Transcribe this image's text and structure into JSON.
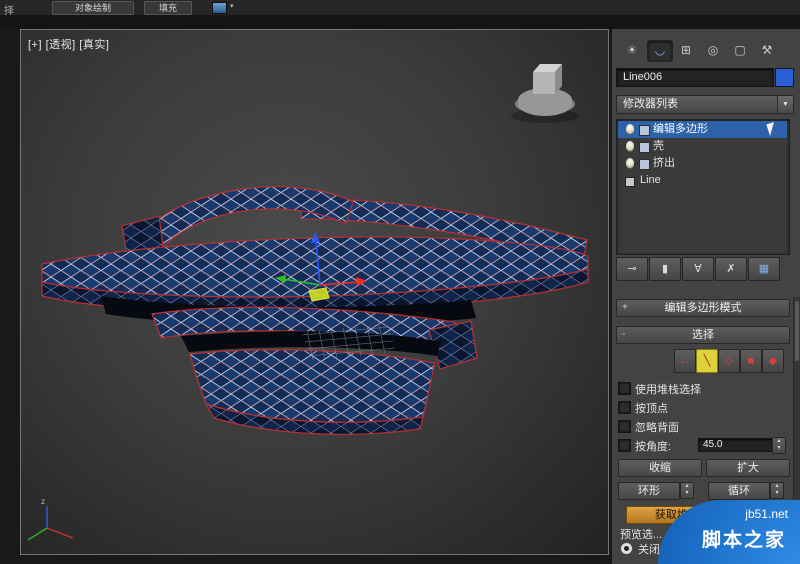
{
  "topbar": {
    "partial_left": "择",
    "tabs": [
      {
        "label": "对象绘制"
      },
      {
        "label": "填充"
      }
    ],
    "caret": "▾"
  },
  "viewport": {
    "label": "[+] [透视] [真实]",
    "axis_label": "z"
  },
  "panel": {
    "tabs": [
      {
        "name": "create",
        "glyph": "☀"
      },
      {
        "name": "modify",
        "glyph": "◡"
      },
      {
        "name": "hierarchy",
        "glyph": "⊞"
      },
      {
        "name": "motion",
        "glyph": "◎"
      },
      {
        "name": "display",
        "glyph": "▢"
      },
      {
        "name": "utilities",
        "glyph": "⚒"
      }
    ],
    "object_name": "Line006",
    "object_color": "#2b5fd6",
    "modifier_list_label": "修改器列表",
    "dropdown_arrow": "▼",
    "stack": [
      {
        "label": "编辑多边形",
        "selected": true
      },
      {
        "label": "壳",
        "selected": false
      },
      {
        "label": "挤出",
        "selected": false
      },
      {
        "label": "Line",
        "selected": false
      }
    ],
    "stack_tools": [
      {
        "name": "pin-stack",
        "glyph": "⊸"
      },
      {
        "name": "show-end-result",
        "glyph": "▮"
      },
      {
        "name": "make-unique",
        "glyph": "∀"
      },
      {
        "name": "remove-modifier",
        "glyph": "✗"
      },
      {
        "name": "configure-modifier-sets",
        "glyph": "▦"
      }
    ],
    "rollouts": [
      {
        "sign": "+",
        "label": "编辑多边形模式"
      },
      {
        "sign": "-",
        "label": "选择"
      }
    ],
    "subobject": [
      {
        "name": "vertex",
        "glyph": "∴",
        "active": false
      },
      {
        "name": "edge",
        "glyph": "╲",
        "active": true
      },
      {
        "name": "border",
        "glyph": "◇",
        "active": false
      },
      {
        "name": "polygon",
        "glyph": "■",
        "active": false
      },
      {
        "name": "element",
        "glyph": "◆",
        "active": false
      }
    ],
    "checkboxes": [
      {
        "label": "使用堆栈选择",
        "checked": false
      },
      {
        "label": "按顶点",
        "checked": false
      },
      {
        "label": "忽略背面",
        "checked": false
      },
      {
        "label": "按角度:",
        "checked": false,
        "value": "45.0"
      }
    ],
    "buttons": {
      "shrink": "收缩",
      "grow": "扩大",
      "ring": "环形",
      "loop": "循环",
      "get_stack": "获取堆...",
      "preview_label": "预览选...",
      "radio_off": "关闭"
    },
    "spinner_up": "▴",
    "spinner_down": "▾",
    "selected_color": "#2d62aa"
  },
  "watermark": {
    "url": "jb51.net",
    "name": "脚本之家",
    "bg": "#1c6fc8"
  }
}
